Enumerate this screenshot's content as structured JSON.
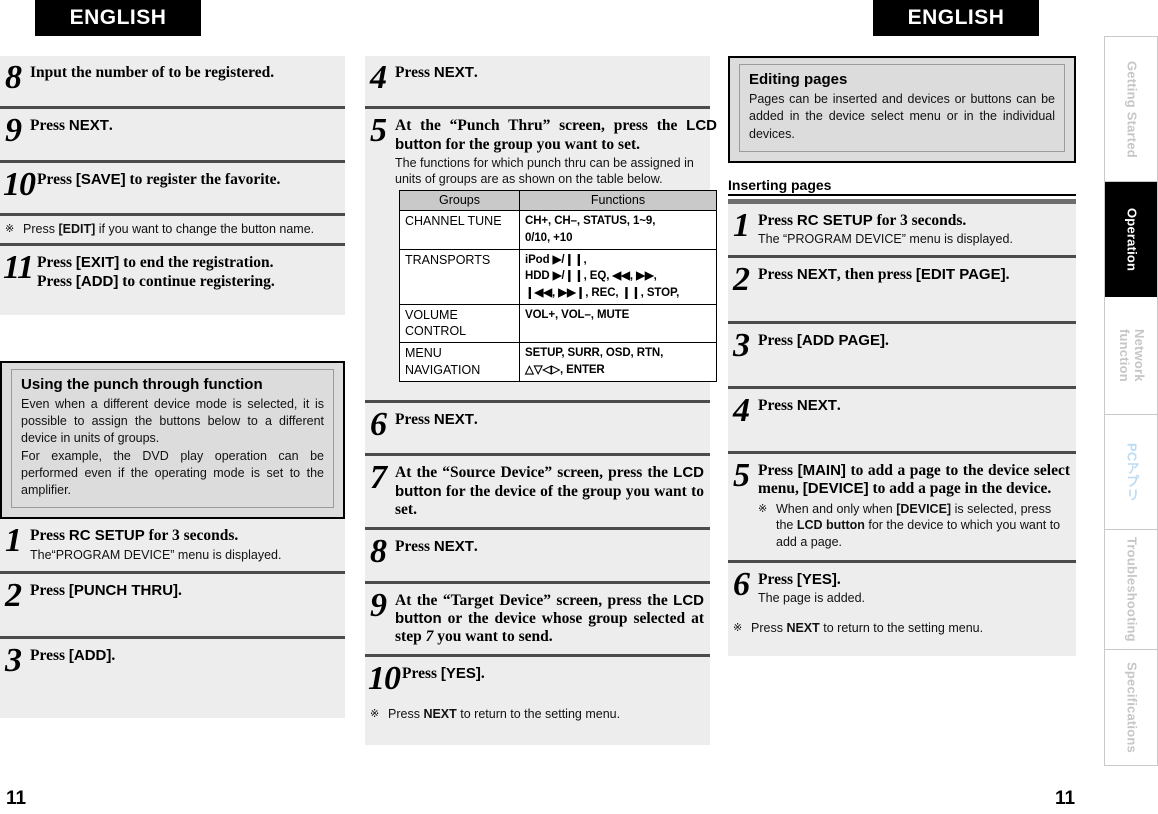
{
  "banners": {
    "left": "ENGLISH",
    "right": "ENGLISH"
  },
  "page_numbers": {
    "left": "11",
    "right": "11"
  },
  "column1": {
    "steps_top": [
      {
        "num": "8",
        "title_pre": "Input the number of to be registered.",
        "title_mid": "",
        "title_post": ""
      },
      {
        "num": "9",
        "title_pre": "Press ",
        "title_mid": "NEXT",
        "title_post": "."
      },
      {
        "num": "10",
        "title_pre": "Press ",
        "title_mid": "[SAVE]",
        "title_post": " to register the favorite."
      }
    ],
    "note_edit": {
      "mark": "※",
      "pre": "Press ",
      "bold": "[EDIT]",
      "post": " if you want to change the button name."
    },
    "step11": {
      "num": "11",
      "line1_pre": "Press ",
      "line1_mid": "[EXIT]",
      "line1_post": " to end the registration.",
      "line2_pre": "Press ",
      "line2_mid": "[ADD]",
      "line2_post": " to continue registering."
    },
    "callout": {
      "title": "Using the punch through function",
      "para1": "Even when a different device mode is selected, it is possible to assign the buttons below to a different device in units of groups.",
      "para2": "For example, the DVD play operation can be performed even if the operating mode is set to the amplifier."
    },
    "steps_bottom": [
      {
        "num": "1",
        "title_pre": "Press ",
        "title_mid": "RC SETUP",
        "title_post": " for 3 seconds.",
        "sub": "The“PROGRAM DEVICE” menu is displayed."
      },
      {
        "num": "2",
        "title_pre": "Press ",
        "title_mid": "[PUNCH THRU]",
        "title_post": ".",
        "sub": ""
      },
      {
        "num": "3",
        "title_pre": "Press ",
        "title_mid": "[ADD]",
        "title_post": ".",
        "sub": ""
      }
    ]
  },
  "column2": {
    "step4": {
      "num": "4",
      "title_pre": "Press ",
      "title_mid": "NEXT",
      "title_post": "."
    },
    "step5": {
      "num": "5",
      "title_a": "At the “Punch Thru” screen, press the ",
      "title_b": "LCD button",
      "title_c": " for the group you want to set.",
      "sub": "The functions for which punch thru can be assigned in units of groups are as shown on the table below."
    },
    "table": {
      "headers": [
        "Groups",
        "Functions"
      ],
      "rows": [
        {
          "group": "CHANNEL TUNE",
          "functions": "CH+, CH–, STATUS, 1~9,\n0/10, +10"
        },
        {
          "group": "TRANSPORTS",
          "functions": "iPod ▶/❙❙,\nHDD ▶/❙❙, EQ, ◀◀, ▶▶,\n❙◀◀, ▶▶❙, REC, ❙❙, STOP,"
        },
        {
          "group": "VOLUME\nCONTROL",
          "functions": "VOL+, VOL–, MUTE"
        },
        {
          "group": "MENU\nNAVIGATION",
          "functions": "SETUP, SURR, OSD, RTN,\n△▽◁▷,  ENTER"
        }
      ]
    },
    "step6": {
      "num": "6",
      "title_pre": "Press ",
      "title_mid": "NEXT",
      "title_post": "."
    },
    "step7": {
      "num": "7",
      "title_a": "At the “Source Device” screen, press the ",
      "title_b": "LCD button",
      "title_c": " for the device of the group you want to set."
    },
    "step8": {
      "num": "8",
      "title_pre": "Press ",
      "title_mid": "NEXT",
      "title_post": "."
    },
    "step9": {
      "num": "9",
      "title_a": "At the “Target Device” screen, press the ",
      "title_b": "LCD button",
      "title_c": " or the device whose group selected at step ",
      "title_d": "7",
      "title_e": " you want to send."
    },
    "step10": {
      "num": "10",
      "title_pre": "Press ",
      "title_mid": "[YES]",
      "title_post": "."
    },
    "note_next": {
      "mark": "※",
      "pre": "Press ",
      "bold": "NEXT",
      "post": " to return to the setting menu."
    }
  },
  "column3": {
    "callout": {
      "title": "Editing pages",
      "text": "Pages can be inserted and devices or buttons can be added in the device select menu or in the individual devices."
    },
    "section_heading": "Inserting pages",
    "step1": {
      "num": "1",
      "title_pre": "Press ",
      "title_mid": "RC SETUP",
      "title_post": " for 3 seconds.",
      "sub": "The “PROGRAM DEVICE” menu is displayed."
    },
    "step2": {
      "num": "2",
      "title_pre": "Press ",
      "title_mid": "NEXT",
      "title_post": ", then press ",
      "title_mid2": "[EDIT PAGE]",
      "title_post2": "."
    },
    "step3": {
      "num": "3",
      "title_pre": "Press ",
      "title_mid": "[ADD PAGE]",
      "title_post": "."
    },
    "step4": {
      "num": "4",
      "title_pre": "Press ",
      "title_mid": "NEXT",
      "title_post": "."
    },
    "step5": {
      "num": "5",
      "t_a": "Press ",
      "t_b": "[MAIN]",
      "t_c": " to add a page to the device select menu, ",
      "t_d": "[DEVICE]",
      "t_e": " to add a page in the device.",
      "note_mark": "※",
      "note_a": "When and only when ",
      "note_b": "[DEVICE]",
      "note_c": " is selected, press the ",
      "note_d": "LCD button",
      "note_e": " for the device to which you want to add a page."
    },
    "step6": {
      "num": "6",
      "title_pre": "Press ",
      "title_mid": "[YES]",
      "title_post": ".",
      "sub": "The page is added."
    },
    "note_next": {
      "mark": "※",
      "pre": "Press ",
      "bold": "NEXT",
      "post": " to return to the setting menu."
    }
  },
  "sidebar": {
    "tabs": [
      {
        "label": "Getting Started",
        "state": "inactive"
      },
      {
        "label": "Operation",
        "state": "active"
      },
      {
        "label": "Network\nfunction",
        "state": "inactive"
      },
      {
        "label": "PCアプリ",
        "state": "pc"
      },
      {
        "label": "Troubleshooting",
        "state": "inactive"
      },
      {
        "label": "Specifications",
        "state": "inactive"
      }
    ]
  },
  "colors": {
    "block_bg": "#ededed",
    "divider": "#4b4b4b",
    "callout_bg": "#dcdcdc",
    "table_header_bg": "#c9c9c9",
    "pc_tab_text": "#bcdcf2",
    "inactive_tab_text": "#c6c6c6"
  }
}
